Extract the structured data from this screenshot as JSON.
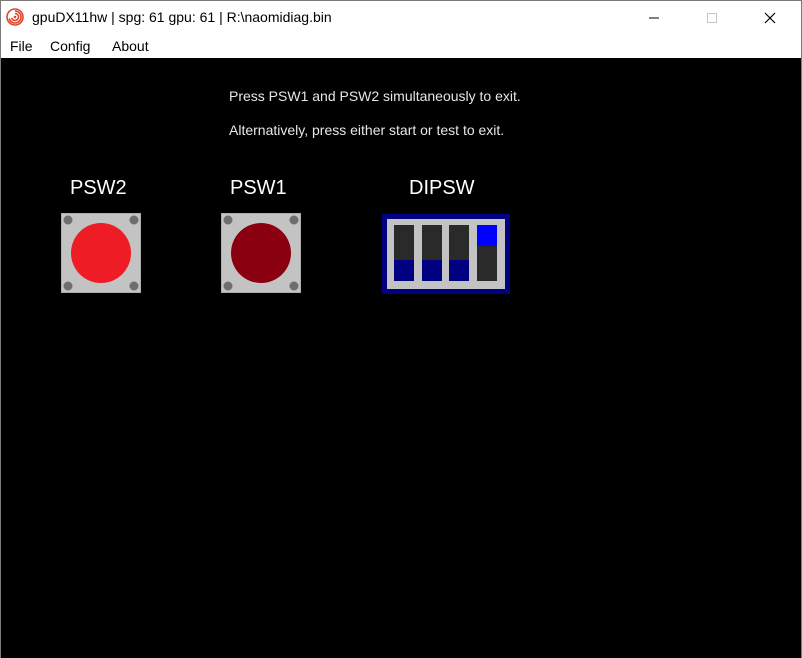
{
  "window": {
    "title": "gpuDX11hw | spg: 61 gpu: 61 | R:\\naomidiag.bin",
    "app_icon": "dreamcast-swirl-icon",
    "controls": [
      "minimize-icon",
      "maximize-icon",
      "close-icon"
    ]
  },
  "menu": {
    "file": "File",
    "config": "Config",
    "about": "About"
  },
  "screen": {
    "line1": "Press PSW1 and PSW2 simultaneously to exit.",
    "line2": "Alternatively, press either start or test to exit.",
    "switches": {
      "psw2": {
        "label": "PSW2",
        "state": "released",
        "color": "#ee1c25"
      },
      "psw1": {
        "label": "PSW1",
        "state": "pressed",
        "color": "#8b0010"
      },
      "dipsw": {
        "label": "DIPSW",
        "positions": [
          "off",
          "off",
          "off",
          "on"
        ]
      }
    }
  },
  "colors": {
    "background": "#000000",
    "text": "#e6e6e6",
    "dip_frame": "#000080",
    "dip_on": "#0000ff",
    "dip_off": "#000080"
  }
}
